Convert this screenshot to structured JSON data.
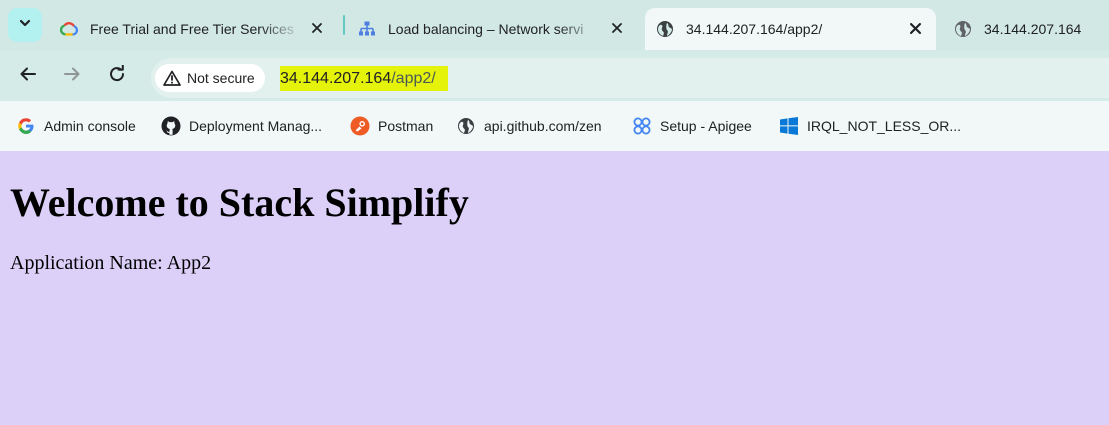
{
  "tabs": [
    {
      "title": "Free Trial and Free Tier Services",
      "icon": "google-cloud-icon",
      "active": false
    },
    {
      "title": "Load balancing – Network servi",
      "icon": "load-balancer-icon",
      "active": false
    },
    {
      "title": "34.144.207.164/app2/",
      "icon": "globe-icon",
      "active": true
    },
    {
      "title": "34.144.207.164",
      "icon": "globe-icon",
      "active": false
    }
  ],
  "address_bar": {
    "security_label": "Not secure",
    "url_host": "34.144.207.164",
    "url_path": "/app2/"
  },
  "bookmarks": [
    {
      "label": "Admin console",
      "icon": "google-icon"
    },
    {
      "label": "Deployment Manag...",
      "icon": "github-icon"
    },
    {
      "label": "Postman",
      "icon": "postman-icon"
    },
    {
      "label": "api.github.com/zen",
      "icon": "globe-icon"
    },
    {
      "label": "Setup - Apigee",
      "icon": "apigee-icon"
    },
    {
      "label": "IRQL_NOT_LESS_OR...",
      "icon": "windows-icon"
    }
  ],
  "page": {
    "heading": "Welcome to Stack Simplify",
    "app_line": "Application Name: App2"
  },
  "colors": {
    "tabstrip_bg": "#d2e8e5",
    "active_tab_bg": "#f1f8f7",
    "url_highlight": "#e5f209",
    "page_bg": "#dcd0f9"
  }
}
